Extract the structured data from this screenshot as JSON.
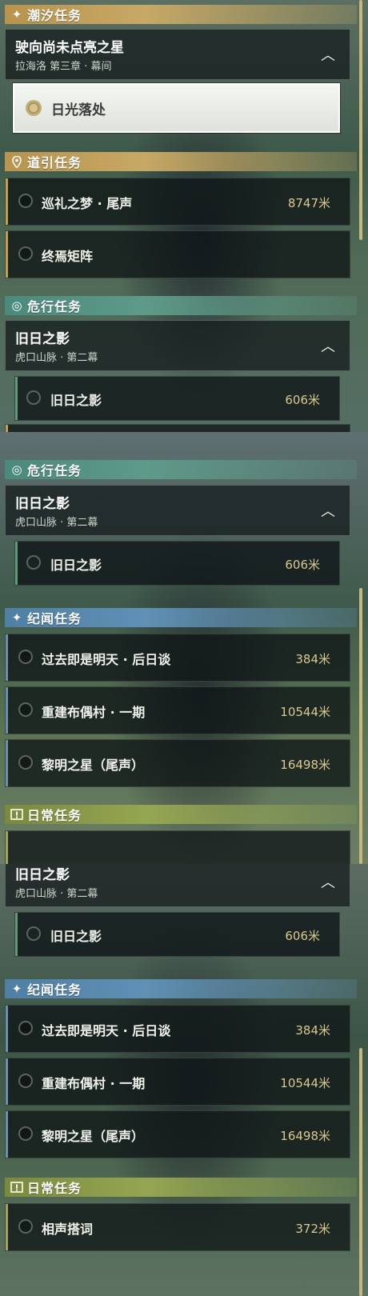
{
  "headers": {
    "tide": "潮汐任务",
    "guide": "道引任务",
    "danger": "危行任务",
    "legend": "纪闻任务",
    "daily": "日常任务"
  },
  "icons": {
    "tide": "sparkle-icon",
    "guide": "location-pin-icon",
    "danger": "radar-icon",
    "legend": "sparkle-icon",
    "daily": "exclamation-box-icon",
    "collapse": "chevron-up-icon"
  },
  "colors": {
    "gold": "#c59d4e",
    "teal": "#5e9a89",
    "blue": "#6090b5",
    "olive": "#95a652",
    "distance": "#d9c98e"
  },
  "tide_quest": {
    "title": "驶向尚未点亮之星",
    "subtitle": "拉海洛 第三章 · 幕间",
    "objective": "日光落处"
  },
  "guide_quests": [
    {
      "name": "巡礼之梦 · 尾声",
      "distance": "8747米"
    },
    {
      "name": "终焉矩阵",
      "distance": ""
    }
  ],
  "danger_quest": {
    "title": "旧日之影",
    "subtitle": "虎口山脉 · 第二幕",
    "objective": "旧日之影",
    "distance": "606米"
  },
  "legend_quests": [
    {
      "name": "过去即是明天 · 后日谈",
      "distance": "384米"
    },
    {
      "name": "重建布偶村 · 一期",
      "distance": "10544米"
    },
    {
      "name": "黎明之星（尾声）",
      "distance": "16498米"
    }
  ],
  "daily_quests": [
    {
      "name": "相声搭词",
      "distance": "372米"
    }
  ]
}
